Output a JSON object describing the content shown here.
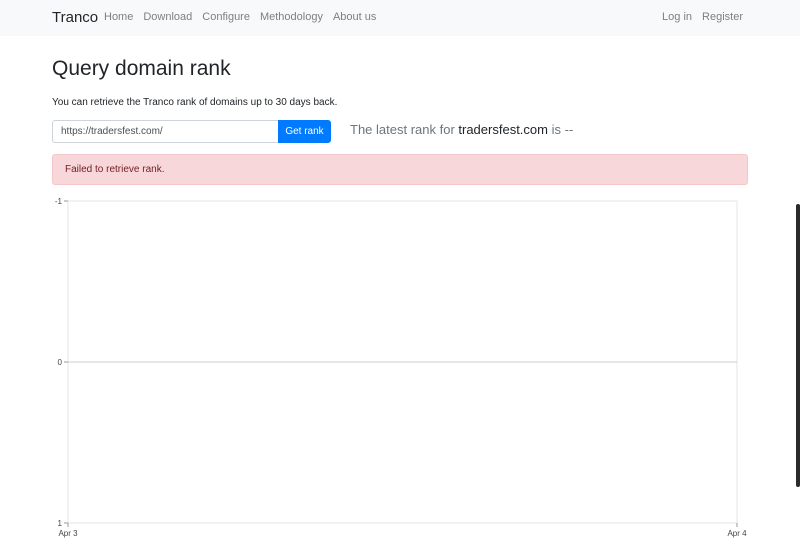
{
  "nav": {
    "brand": "Tranco",
    "links": [
      "Home",
      "Download",
      "Configure",
      "Methodology",
      "About us"
    ],
    "right_links": [
      "Log in",
      "Register"
    ]
  },
  "page": {
    "title": "Query domain rank",
    "lead": "You can retrieve the Tranco rank of domains up to 30 days back."
  },
  "query": {
    "input_value": "https://tradersfest.com/",
    "button_label": "Get rank"
  },
  "result": {
    "prefix": "The latest rank for ",
    "domain": "tradersfest.com",
    "middle": " is ",
    "rank": "--"
  },
  "alert": {
    "text": "Failed to retrieve rank."
  },
  "chart_data": {
    "type": "line",
    "title": "",
    "xlabel": "",
    "ylabel": "",
    "x_ticks": [
      "Apr 3",
      "Apr 4"
    ],
    "y_ticks": [
      "-1",
      "0",
      "1"
    ],
    "ylim": [
      -1,
      1
    ],
    "y_reversed": true,
    "series": [],
    "grid": "horizontal line at 0",
    "zero_line_color": "#cccccc"
  }
}
